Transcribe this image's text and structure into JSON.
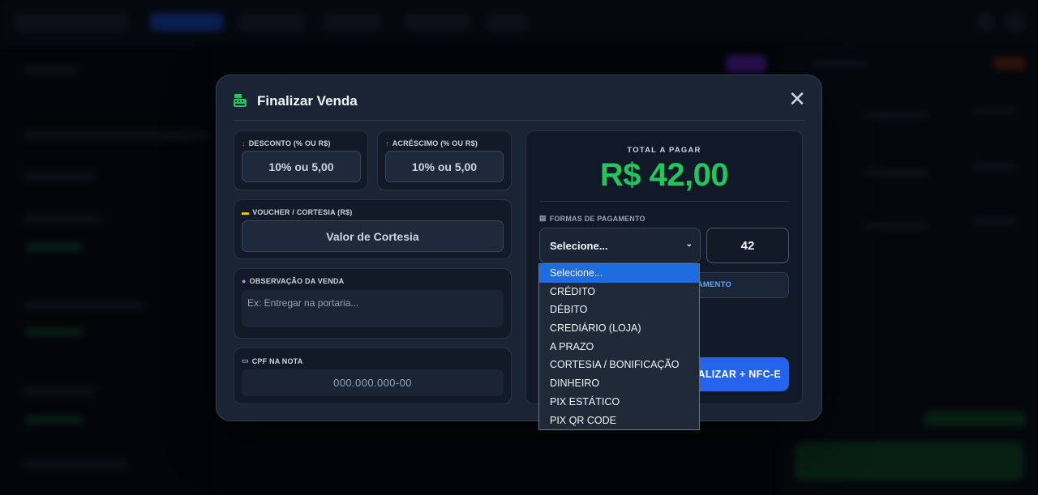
{
  "modal": {
    "title": "Finalizar Venda",
    "close_label": "✕",
    "discount": {
      "label": "DESCONTO (% OU R$)",
      "placeholder": "10% ou 5,00",
      "color": "#ef4444"
    },
    "surcharge": {
      "label": "ACRÉSCIMO (% OU R$)",
      "placeholder": "10% ou 5,00",
      "color": "#60a5fa"
    },
    "voucher": {
      "label": "VOUCHER / CORTESIA (R$)",
      "placeholder": "Valor de Cortesia"
    },
    "observation": {
      "label": "OBSERVAÇÃO DA VENDA",
      "placeholder": "Ex: Entregar na portaria..."
    },
    "cpf": {
      "label": "CPF NA NOTA",
      "placeholder": "000.000.000-00"
    },
    "total_label": "TOTAL A PAGAR",
    "total_value": "R$ 42,00",
    "payment_label": "FORMAS DE PAGAMENTO",
    "payment_select_value": "Selecione...",
    "payment_amount": "42",
    "add_payment_visible": "AMENTO",
    "finalize_visible": "NALIZAR + NFC-E",
    "payment_options": [
      "Selecione...",
      "CRÉDITO",
      "DÉBITO",
      "CREDIÁRIO (LOJA)",
      "A PRAZO",
      "CORTESIA / BONIFICAÇÃO",
      "DINHEIRO",
      "PIX ESTÁTICO",
      "PIX QR CODE"
    ],
    "selected_option_index": 0
  },
  "colors": {
    "accent_green": "#22c55e",
    "accent_blue": "#2563eb",
    "highlight": "#1d6ce0"
  },
  "icons": {
    "title": "cash-register-icon",
    "discount": "arrow-down-icon",
    "surcharge": "arrow-up-icon",
    "voucher": "ticket-icon",
    "observation": "chat-bubble-icon",
    "cpf": "id-card-icon",
    "payment": "wallet-icon",
    "close": "close-icon"
  }
}
